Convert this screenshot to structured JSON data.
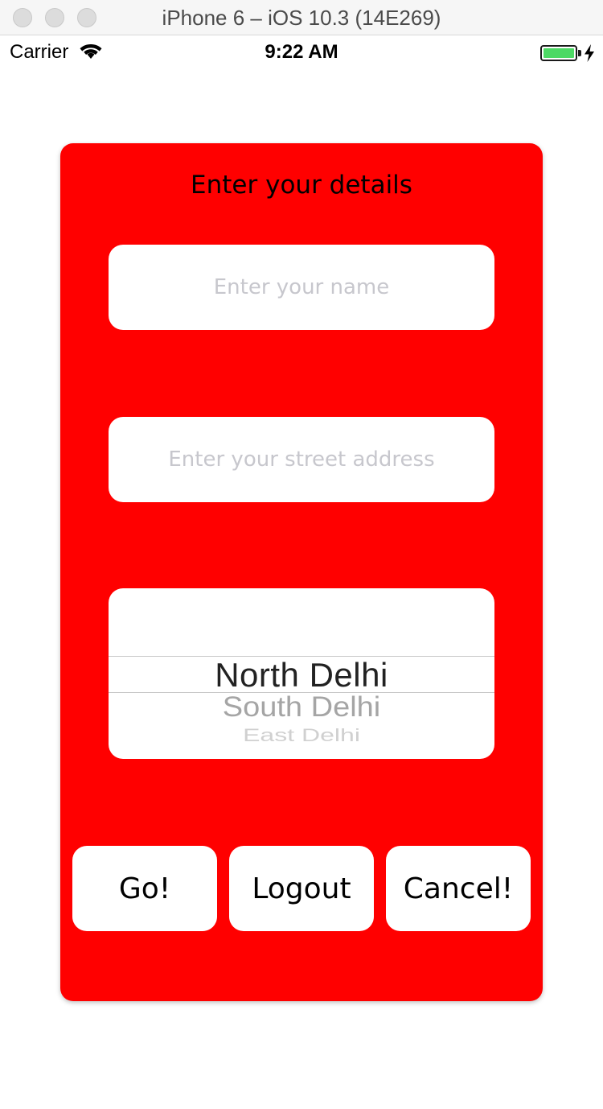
{
  "window": {
    "title": "iPhone 6 – iOS 10.3 (14E269)"
  },
  "status_bar": {
    "carrier": "Carrier",
    "time": "9:22 AM",
    "battery_color": "#4cd964"
  },
  "form": {
    "title": "Enter your details",
    "background_color": "#ff0000",
    "name_field": {
      "value": "",
      "placeholder": "Enter your name"
    },
    "address_field": {
      "value": "",
      "placeholder": "Enter your street address"
    },
    "region_picker": {
      "selected": "North Delhi",
      "following": [
        "South Delhi",
        "East Delhi"
      ]
    },
    "buttons": {
      "go": "Go!",
      "logout": "Logout",
      "cancel": "Cancel!"
    }
  }
}
